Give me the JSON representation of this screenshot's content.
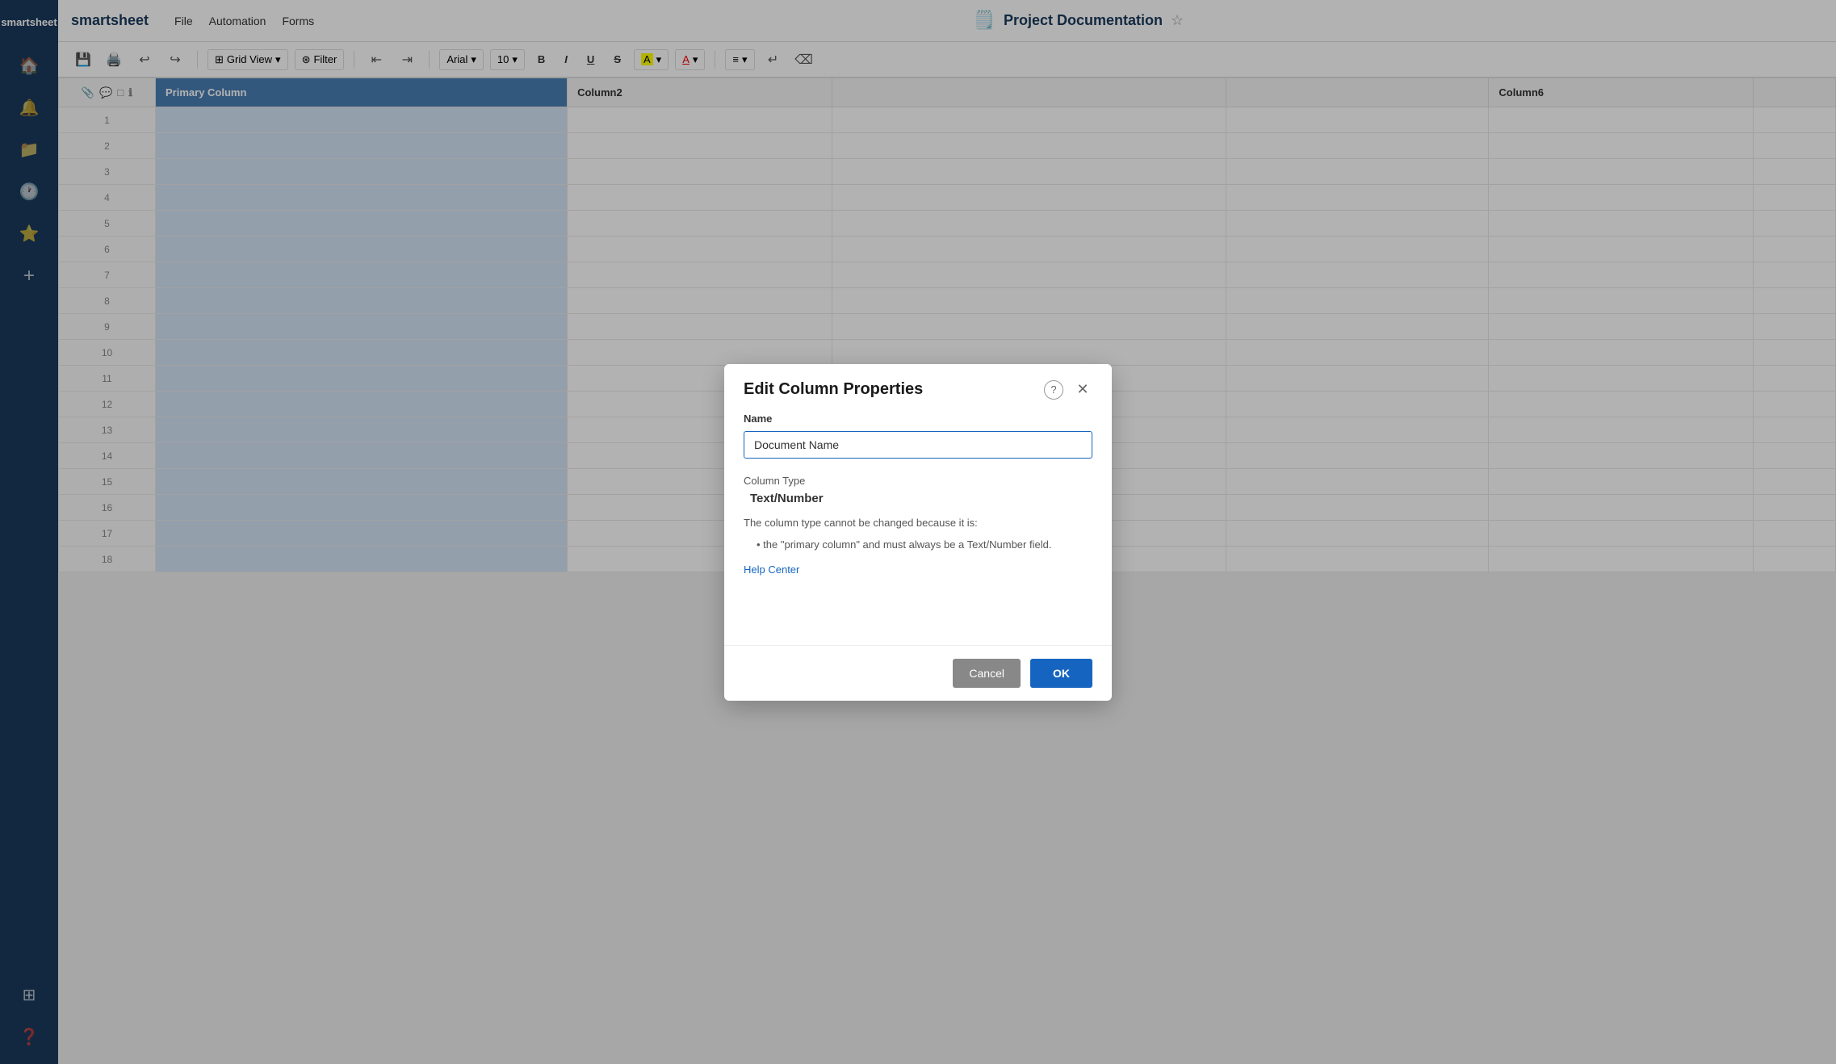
{
  "app": {
    "name": "smartsheet"
  },
  "topbar": {
    "nav_items": [
      "File",
      "Automation",
      "Forms"
    ],
    "doc_title": "Project Documentation",
    "star_icon": "☆"
  },
  "toolbar": {
    "grid_view_label": "Grid View",
    "filter_label": "Filter",
    "font_label": "Arial",
    "font_size_label": "10"
  },
  "sheet": {
    "primary_column_label": "Primary Column",
    "columns": [
      "Column2",
      "",
      "Column6"
    ],
    "rows": [
      1,
      2,
      3,
      4,
      5,
      6,
      7,
      8,
      9,
      10,
      11,
      12,
      13,
      14,
      15,
      16,
      17,
      18
    ]
  },
  "dialog": {
    "title": "Edit Column Properties",
    "name_label": "Name",
    "name_value": "Document Name",
    "column_type_label": "Column Type",
    "column_type_value": "Text/Number",
    "info_text": "The column type cannot be changed because it is:",
    "bullet_text": "the \"primary column\" and must always be a Text/Number field.",
    "help_link_label": "Help Center",
    "cancel_label": "Cancel",
    "ok_label": "OK"
  },
  "sidebar": {
    "icons": [
      "home",
      "bell",
      "folder",
      "clock",
      "star",
      "plus"
    ],
    "bottom_icons": [
      "grid",
      "question"
    ]
  }
}
